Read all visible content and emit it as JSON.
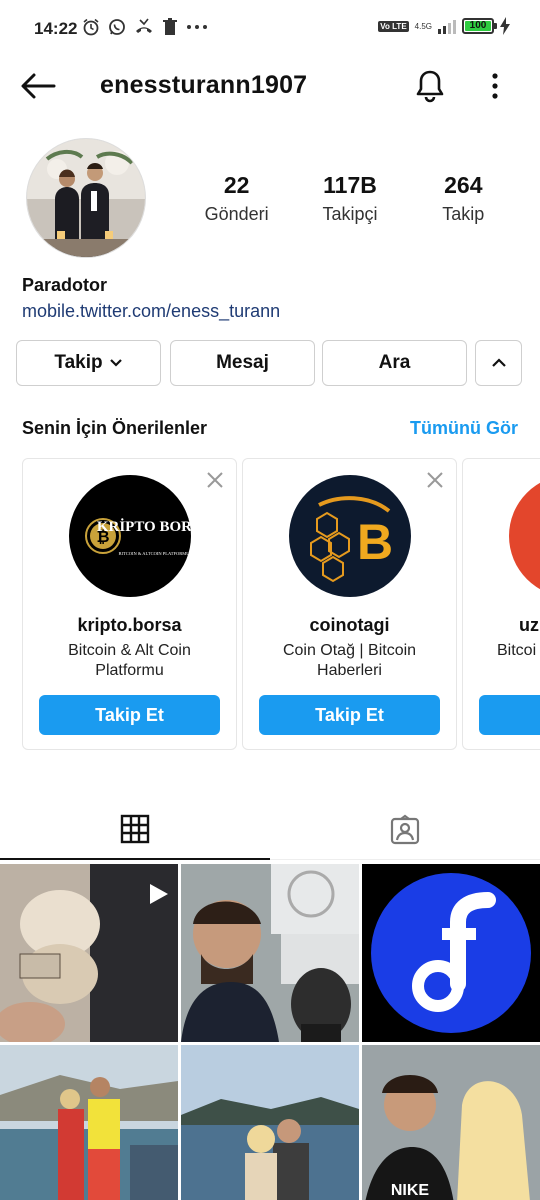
{
  "status_bar": {
    "time": "14:22",
    "icons": [
      "alarm-icon",
      "whatsapp-icon",
      "missed-call-icon",
      "trash-icon",
      "more-dots-icon"
    ],
    "volte": "Vo LTE",
    "network": "4.5G",
    "battery": "100"
  },
  "header": {
    "username": "enessturann1907",
    "icons": {
      "back": "arrow-left-icon",
      "notifications": "bell-icon",
      "menu": "more-vert-icon"
    }
  },
  "profile": {
    "stats": [
      {
        "value": "22",
        "label": "Gönderi"
      },
      {
        "value": "117B",
        "label": "Takipçi"
      },
      {
        "value": "264",
        "label": "Takip"
      }
    ],
    "display_name": "Paradotor",
    "link": "mobile.twitter.com/eness_turann"
  },
  "actions": {
    "follow": "Takip",
    "message": "Mesaj",
    "call": "Ara"
  },
  "suggestions": {
    "title": "Senin İçin Önerilenler",
    "see_all": "Tümünü Gör",
    "cards": [
      {
        "name": "kripto.borsa",
        "desc": "Bitcoin & Alt Coin Platformu",
        "button": "Takip Et",
        "logo_text": "KRİPTO BORSA",
        "logo_sub": "BITCOIN & ALTCOIN PLATFORMU"
      },
      {
        "name": "coinotagi",
        "desc": "Coin Otağ | Bitcoin Haberleri",
        "button": "Takip Et"
      },
      {
        "name": "uz",
        "desc": "Bitcoi",
        "button": ""
      }
    ]
  },
  "tabs": {
    "grid": "grid-icon",
    "tagged": "tagged-person-icon"
  },
  "colors": {
    "accent": "#1a9bf0",
    "link": "#1f3b74",
    "battery": "#2ecc40"
  }
}
